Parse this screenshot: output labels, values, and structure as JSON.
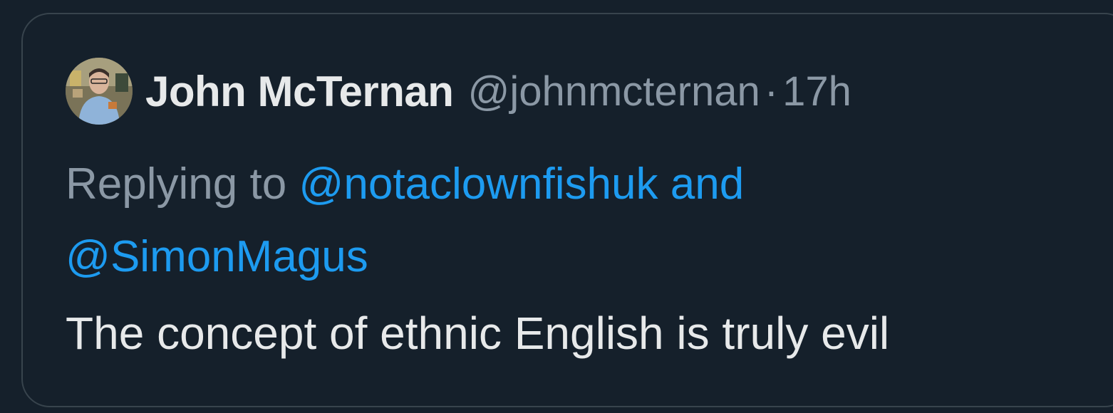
{
  "tweet": {
    "author_name": "John McTernan",
    "author_handle": "@johnmcternan",
    "separator": "·",
    "timestamp": "17h",
    "replying_prefix": "Replying to",
    "mentions": [
      "@notaclownfishuk",
      "@SimonMagus"
    ],
    "mention_joiner": "and",
    "text": "The concept of ethnic English is truly evil"
  },
  "colors": {
    "background": "#15202b",
    "border": "#38444d",
    "primary_text": "#e7e9ea",
    "secondary_text": "#8b98a5",
    "link": "#1d9bf0"
  }
}
